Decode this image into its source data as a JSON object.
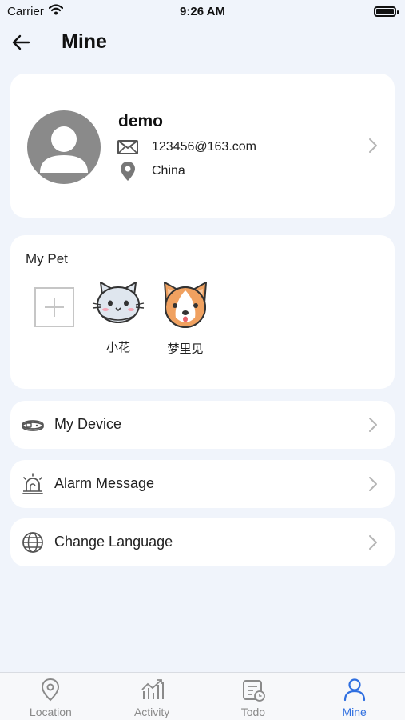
{
  "status_bar": {
    "carrier": "Carrier",
    "time": "9:26 AM"
  },
  "header": {
    "title": "Mine"
  },
  "profile": {
    "name": "demo",
    "email": "123456@163.com",
    "location": "China"
  },
  "pets": {
    "title": "My Pet",
    "items": [
      {
        "name": "小花",
        "icon": "cat-avatar-icon"
      },
      {
        "name": "梦里见",
        "icon": "dog-avatar-icon"
      }
    ]
  },
  "menu": {
    "items": [
      {
        "label": "My Device",
        "icon": "collar-icon"
      },
      {
        "label": "Alarm Message",
        "icon": "alarm-siren-icon"
      },
      {
        "label": "Change Language",
        "icon": "globe-icon"
      }
    ]
  },
  "tabs": [
    {
      "label": "Location",
      "icon": "location-pin-icon"
    },
    {
      "label": "Activity",
      "icon": "activity-chart-icon"
    },
    {
      "label": "Todo",
      "icon": "todo-calendar-icon"
    },
    {
      "label": "Mine",
      "icon": "person-icon",
      "active": true
    }
  ],
  "colors": {
    "accent": "#2f6fe0",
    "background": "#f0f4fb",
    "card": "#ffffff",
    "inactive": "#8a8a8a"
  }
}
